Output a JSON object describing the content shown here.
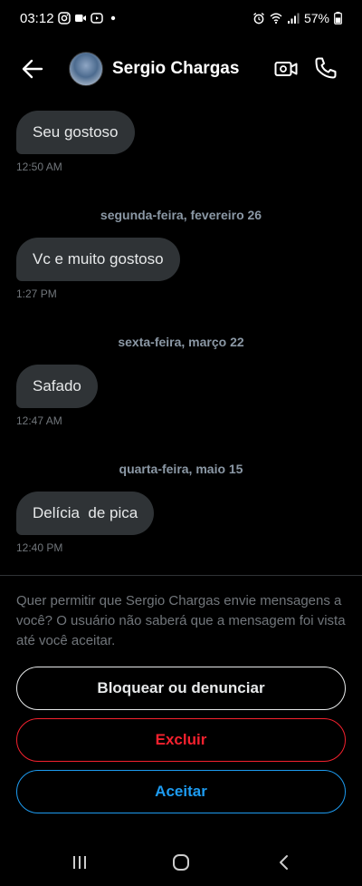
{
  "status_bar": {
    "time": "03:12",
    "battery": "57%",
    "left_icons": [
      "instagram-icon",
      "video-camera-icon",
      "media-icon",
      "dot-icon"
    ],
    "right_icons": [
      "alarm-icon",
      "wifi-icon",
      "signal-icon",
      "battery-icon"
    ]
  },
  "header": {
    "contact_name": "Sergio Chargas"
  },
  "messages": [
    {
      "text": "Seu gostoso",
      "time": "12:50 AM"
    },
    {
      "date": "segunda-feira, fevereiro 26",
      "text": "Vc e muito gostoso",
      "time": "1:27 PM"
    },
    {
      "date": "sexta-feira, março 22",
      "text": "Safado",
      "time": "12:47 AM"
    },
    {
      "date": "quarta-feira, maio 15",
      "text": "Delícia  de pica",
      "time": "12:40 PM"
    }
  ],
  "request_prompt": "Quer permitir que Sergio Chargas envie mensagens a você? O usuário não saberá que a mensagem foi vista até você aceitar.",
  "actions": {
    "block_label": "Bloquear ou denunciar",
    "delete_label": "Excluir",
    "accept_label": "Aceitar"
  },
  "colors": {
    "background": "#000000",
    "bubble": "#2f3336",
    "delete": "#f4212e",
    "accept": "#1d9bf0"
  }
}
